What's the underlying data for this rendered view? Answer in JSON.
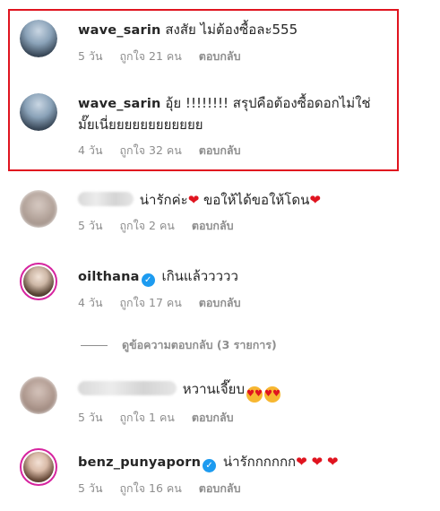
{
  "comments": [
    {
      "username": "wave_sarin",
      "text": "สงสัย ไม่ต้องซื้อละ555",
      "time": "5 วัน",
      "likes": "ถูกใจ 21 คน",
      "reply": "ตอบกลับ"
    },
    {
      "username": "wave_sarin",
      "text": "อุ้ย !!!!!!!! สรุปคือต้องซื้อดอกไม่ใช่มั๊ยเนี่ยยยยยยยยยยยย",
      "time": "4 วัน",
      "likes": "ถูกใจ 32 คน",
      "reply": "ตอบกลับ"
    },
    {
      "username": "",
      "text": "น่ารักค่ะ",
      "text2": "ขอให้ได้ขอให้โดน",
      "time": "5 วัน",
      "likes": "ถูกใจ 2 คน",
      "reply": "ตอบกลับ"
    },
    {
      "username": "oilthana",
      "text": "เกินแล้ววววว",
      "time": "4 วัน",
      "likes": "ถูกใจ 17 คน",
      "reply": "ตอบกลับ"
    },
    {
      "username": "",
      "text": "หวานเจี๊ยบ",
      "time": "5 วัน",
      "likes": "ถูกใจ 1 คน",
      "reply": "ตอบกลับ"
    },
    {
      "username": "benz_punyaporn",
      "text": "น่ารักกกกกก",
      "time": "5 วัน",
      "likes": "ถูกใจ 16 คน",
      "reply": "ตอบกลับ"
    }
  ],
  "view_replies": "ดูข้อความตอบกลับ (3 รายการ)",
  "colors": {
    "highlight": "#e0141f",
    "verified": "#1d9bf0",
    "meta": "#8e8e8e"
  },
  "icons": [
    "verified-badge-icon",
    "red-heart-icon",
    "heart-eyes-emoji-icon"
  ]
}
